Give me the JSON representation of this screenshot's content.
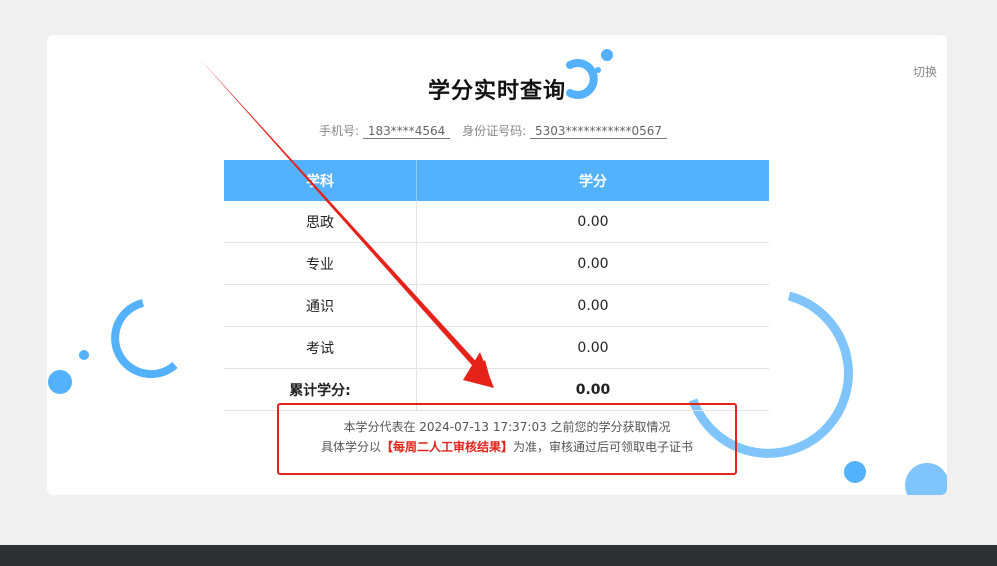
{
  "header": {
    "title": "学分实时查询",
    "switch_label": "切换"
  },
  "user_info": {
    "phone_label": "手机号:",
    "phone_value": "183****4564",
    "id_label": "身份证号码:",
    "id_value": "5303***********0567"
  },
  "table": {
    "headers": [
      "学科",
      "学分"
    ],
    "rows": [
      {
        "subject": "思政",
        "credit": "0.00"
      },
      {
        "subject": "专业",
        "credit": "0.00"
      },
      {
        "subject": "通识",
        "credit": "0.00"
      },
      {
        "subject": "考试",
        "credit": "0.00"
      }
    ],
    "total_label": "累计学分:",
    "total_value": "0.00"
  },
  "note": {
    "line1": "本学分代表在 2024-07-13 17:37:03 之前您的学分获取情况",
    "line2_prefix": "具体学分以",
    "line2_highlight": "【每周二人工审核结果】",
    "line2_suffix": "为准，审核通过后可领取电子证书"
  },
  "colors": {
    "accent": "#53b1fd",
    "annotation_red": "#e5231b"
  }
}
